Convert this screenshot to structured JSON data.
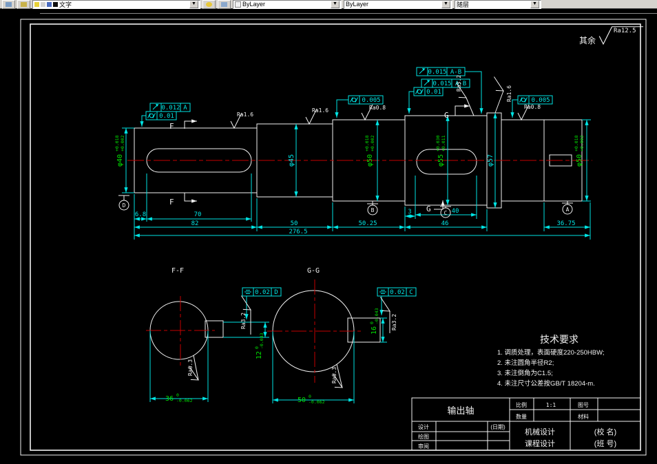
{
  "toolbar": {
    "layer_value": "文字",
    "color_value": "ByLayer",
    "linetype_value": "ByLayer",
    "lineweight_value": "随层"
  },
  "general_note": {
    "prefix": "其余",
    "value": "Ra12.5"
  },
  "view_labels": {
    "ff": "F-F",
    "gg": "G-G",
    "f": "F",
    "g": "G"
  },
  "datums": {
    "d1": "D",
    "d2": "B",
    "d3": "C",
    "d4": "A"
  },
  "gdt": {
    "s1_runout": {
      "tol": "0.012",
      "datum": "A"
    },
    "s1_cyl": {
      "tol": "0.01"
    },
    "s4_runout_a": {
      "tol": "0.015",
      "datum": "A-B"
    },
    "s4_runout_b": {
      "tol": "0.015",
      "datum": "A-B"
    },
    "s4_cyl": {
      "tol": "0.01"
    },
    "s3_cyl": {
      "tol": "0.005"
    },
    "s6_cyl": {
      "tol": "0.005"
    },
    "ff_sym": {
      "tol": "0.02",
      "datum": "D"
    },
    "gg_sym": {
      "tol": "0.02",
      "datum": "C"
    }
  },
  "roughness": {
    "s1": "Ra1.6",
    "s2": "Ra1.6",
    "s3": "Ra0.8",
    "s4_key": "Ra3.2",
    "s5": "Ra1.6",
    "s6": "Ra0.8",
    "ff_side": "Ra3.2",
    "ff_face": "Ra6.3",
    "gg_side": "Ra3.2",
    "gg_face": "Ra6.3"
  },
  "dims": {
    "d40": {
      "v": "φ40",
      "up": "+0.018",
      "lo": "+0.002"
    },
    "d45": "φ45",
    "d50l": {
      "v": "φ50",
      "up": "+0.018",
      "lo": "+0.002"
    },
    "d55": {
      "v": "φ55",
      "up": "+0.030",
      "lo": "+0.011"
    },
    "d57": "φ57",
    "d50r": {
      "v": "φ50",
      "up": "+0.018",
      "lo": "+0.002"
    },
    "l68": "6.8",
    "l70": "70",
    "l82": "82",
    "l50": "50",
    "l5025": "50.25",
    "l3": "3",
    "l40": "40",
    "l46": "46",
    "l3675": "36.75",
    "ltotal": "276.5",
    "ff_w": {
      "v": "36",
      "up": "0",
      "lo": "-0.062"
    },
    "ff_key": {
      "v": "12",
      "up": "0",
      "lo": "-0.043"
    },
    "gg_w": {
      "v": "50",
      "up": "0",
      "lo": "-0.062"
    },
    "gg_key": {
      "v": "16",
      "up": "0",
      "lo": "-0.043"
    }
  },
  "tech_req": {
    "title": "技术要求",
    "item1": "1. 调质处理，表面硬度220-250HBW;",
    "item2": "2. 未注圆角半径R2;",
    "item3": "3. 未注倒角为C1.5;",
    "item4": "4. 未注尺寸公差按GB/T 18204-m."
  },
  "title_block": {
    "part_name": "输出轴",
    "scale_label": "比例",
    "scale_value": "1:1",
    "qty_label": "数量",
    "dwgno_label": "图号",
    "material_label": "材料",
    "design_label": "设计",
    "date_label": "(日期)",
    "draft_label": "绘图",
    "review_label": "审阅",
    "course1": "机械设计",
    "course2": "课程设计",
    "school": "(校  名)",
    "class": "(班  号)"
  }
}
